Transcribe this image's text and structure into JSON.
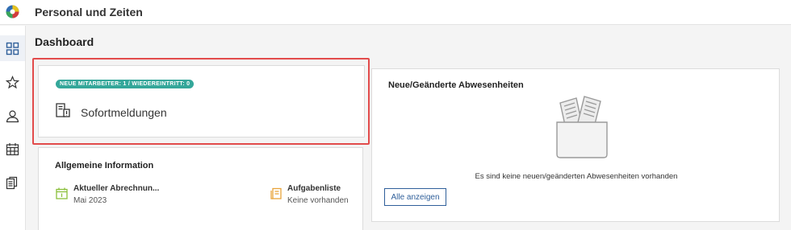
{
  "app": {
    "title": "Personal und Zeiten"
  },
  "sidebar": {
    "items": [
      {
        "icon": "dashboard-grid-icon",
        "active": true
      },
      {
        "icon": "star-icon",
        "active": false
      },
      {
        "icon": "person-icon",
        "active": false
      },
      {
        "icon": "calendar-icon",
        "active": false
      },
      {
        "icon": "documents-icon",
        "active": false
      }
    ]
  },
  "page": {
    "title": "Dashboard"
  },
  "sofortmeldungen": {
    "badge": "NEUE MITARBEITER: 1 / WIEDEREINTRITT: 0",
    "label": "Sofortmeldungen",
    "icon": "report-doc-icon"
  },
  "info": {
    "title": "Allgemeine Information",
    "items": [
      {
        "title": "Aktueller Abrechnun...",
        "sub": "Mai 2023",
        "icon": "calendar-icon",
        "color": "#8bbf3c"
      },
      {
        "title": "Aufgabenliste",
        "sub": "Keine vorhanden",
        "icon": "task-list-icon",
        "color": "#e8a33a"
      }
    ]
  },
  "absences": {
    "title": "Neue/Geänderte Abwesenheiten",
    "empty_text": "Es sind keine neuen/geänderten Abwesenheiten vorhanden",
    "button_label": "Alle anzeigen"
  },
  "colors": {
    "accent": "#2f5f9a",
    "badge": "#34a79a",
    "highlight": "#e24b4b"
  }
}
